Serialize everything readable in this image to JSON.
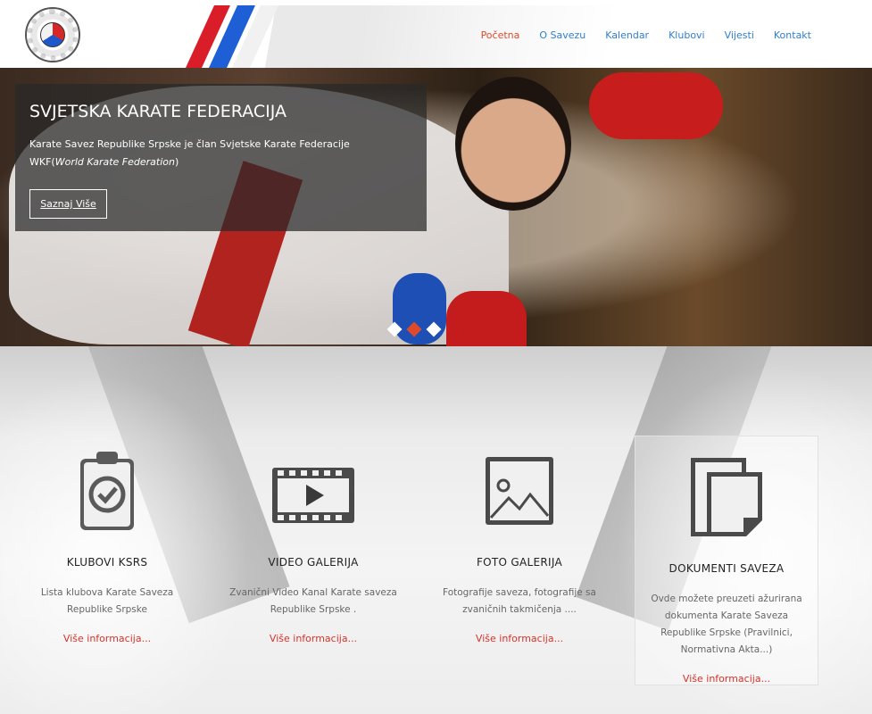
{
  "header": {
    "logo_name": "logo",
    "nav": [
      {
        "label": "Početna",
        "active": true
      },
      {
        "label": "O Savezu",
        "active": false
      },
      {
        "label": "Kalendar",
        "active": false
      },
      {
        "label": "Klubovi",
        "active": false
      },
      {
        "label": "Vijesti",
        "active": false
      },
      {
        "label": "Kontakt",
        "active": false
      }
    ]
  },
  "hero": {
    "title": "SVJETSKA KARATE FEDERACIJA",
    "text_plain": "Karate Savez Republike Srpske je član Svjetske Karate Federacije WKF(",
    "text_italic": "World Karate Federation",
    "text_end": ")",
    "button": "Saznaj Više",
    "slides": 3,
    "active_slide": 2
  },
  "features": [
    {
      "icon": "clipboard-check-icon",
      "title": "KLUBOVI KSRS",
      "desc": "Lista klubova Karate Saveza Republike Srpske",
      "more": "Više informacija..."
    },
    {
      "icon": "film-play-icon",
      "title": "VIDEO GALERIJA",
      "desc": "Zvanični Video Kanal Karate saveza Republike Srpske .",
      "more": "Više informacija..."
    },
    {
      "icon": "image-icon",
      "title": "FOTO GALERIJA",
      "desc": "Fotografije saveza, fotografije sa zvaničnih takmičenja ....",
      "more": "Više informacija..."
    },
    {
      "icon": "documents-icon",
      "title": "DOKUMENTI SAVEZA",
      "desc": "Ovde možete preuzeti ažurirana dokumenta Karate Saveza Republike Srpske (Pravilnici, Normativna Akta...)",
      "more": "Više informacija..."
    }
  ],
  "colors": {
    "accent": "#e0492a",
    "link": "#2f7fd0",
    "more_link": "#d9322a"
  }
}
